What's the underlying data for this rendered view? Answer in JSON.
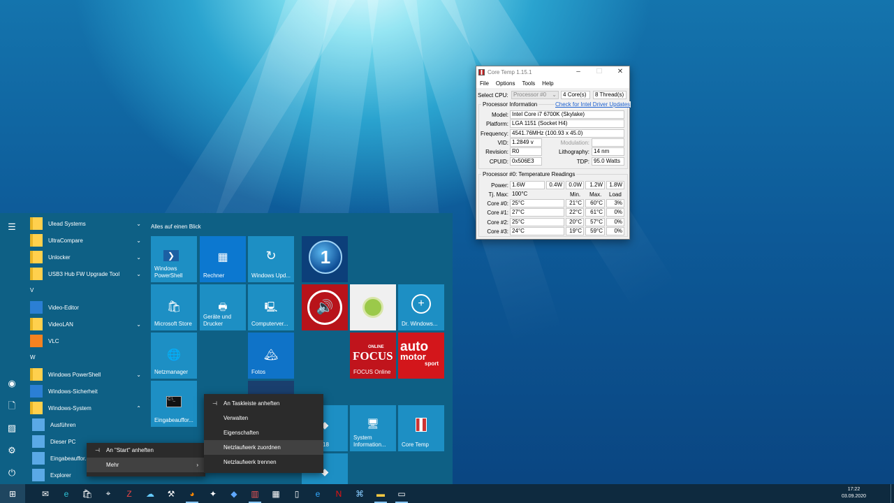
{
  "coretemp": {
    "title": "Core Temp 1.15.1",
    "menu": [
      "File",
      "Options",
      "Tools",
      "Help"
    ],
    "select_cpu_label": "Select CPU:",
    "processor_select": "Processor #0",
    "cores_value": "4",
    "cores_label": "Core(s)",
    "threads_value": "8",
    "threads_label": "Thread(s)",
    "info_group": "Processor Information",
    "driver_link": "Check for Intel Driver Updates",
    "model_label": "Model:",
    "model": "Intel Core i7 6700K (Skylake)",
    "platform_label": "Platform:",
    "platform": "LGA 1151 (Socket H4)",
    "frequency_label": "Frequency:",
    "frequency": "4541.76MHz (100.93 x 45.0)",
    "vid_label": "VID:",
    "vid": "1.2849 v",
    "modulation_label": "Modulation:",
    "modulation": "",
    "revision_label": "Revision:",
    "revision": "R0",
    "lithography_label": "Lithography:",
    "lithography": "14 nm",
    "cpuid_label": "CPUID:",
    "cpuid": "0x506E3",
    "tdp_label": "TDP:",
    "tdp": "95.0 Watts",
    "temp_group": "Processor #0: Temperature Readings",
    "power_label": "Power:",
    "power": [
      "1.6W",
      "0.4W",
      "0.0W",
      "1.2W",
      "1.8W"
    ],
    "tjmax_label": "Tj. Max:",
    "tjmax": "100°C",
    "col_min": "Min.",
    "col_max": "Max.",
    "col_load": "Load",
    "cores": [
      {
        "label": "Core #0:",
        "temp": "25°C",
        "min": "21°C",
        "max": "60°C",
        "load": "3%"
      },
      {
        "label": "Core #1:",
        "temp": "27°C",
        "min": "22°C",
        "max": "61°C",
        "load": "0%"
      },
      {
        "label": "Core #2:",
        "temp": "25°C",
        "min": "20°C",
        "max": "57°C",
        "load": "0%"
      },
      {
        "label": "Core #3:",
        "temp": "24°C",
        "min": "19°C",
        "max": "59°C",
        "load": "0%"
      }
    ]
  },
  "start": {
    "section_title": "Alles auf einen Blick",
    "apps": [
      {
        "label": "Ulead Systems",
        "type": "folder",
        "expand": true
      },
      {
        "label": "UltraCompare",
        "type": "folder",
        "expand": true
      },
      {
        "label": "Unlocker",
        "type": "folder",
        "expand": true
      },
      {
        "label": "USB3 Hub FW Upgrade Tool",
        "type": "folder",
        "expand": true
      },
      {
        "label": "V",
        "type": "letter"
      },
      {
        "label": "Video-Editor",
        "type": "app"
      },
      {
        "label": "VideoLAN",
        "type": "folder",
        "expand": true
      },
      {
        "label": "VLC",
        "type": "app"
      },
      {
        "label": "W",
        "type": "letter"
      },
      {
        "label": "Windows PowerShell",
        "type": "folder",
        "expand": true
      },
      {
        "label": "Windows-Sicherheit",
        "type": "app"
      },
      {
        "label": "Windows-System",
        "type": "folder",
        "collapse": true
      },
      {
        "label": "Ausführen",
        "type": "sub"
      },
      {
        "label": "Dieser PC",
        "type": "sub"
      },
      {
        "label": "Eingabeauffor...",
        "type": "sub"
      },
      {
        "label": "Explorer",
        "type": "sub"
      }
    ],
    "tiles": {
      "powershell": "Windows PowerShell",
      "rechner": "Rechner",
      "windows_update": "Windows Upd...",
      "store": "Microsoft Store",
      "geraete": "Geräte und Drucker",
      "computerverwaltung": "Computerver...",
      "dr_windows": "Dr. Windows...",
      "netzmanager": "Netzmanager",
      "fotos": "Fotos",
      "focus": "FOCUS Online",
      "focus_logo_top": "ONLINE",
      "focus_logo": "FOCUS",
      "auto_logo": "auto",
      "auto_logo2": "motor",
      "auto_logo3": "sport",
      "eingabe": "Eingabeauffor...",
      "partial_18": "18",
      "sysinfo": "System Information...",
      "coretemp": "Core Temp"
    }
  },
  "context_menu_1": {
    "items": [
      "An \"Start\" anheften",
      "Mehr"
    ]
  },
  "context_menu_2": {
    "items": [
      "An Taskleiste anheften",
      "Verwalten",
      "Eigenschaften",
      "Netzlaufwerk zuordnen",
      "Netzlaufwerk trennen"
    ]
  },
  "taskbar": {
    "time": "17:22",
    "date": "03.09.2020"
  },
  "colors": {
    "start_bg": "#0e6085",
    "tile": "#1d8fc4",
    "context_menu": "#2b2b2b",
    "taskbar": "#0e2a3f"
  }
}
